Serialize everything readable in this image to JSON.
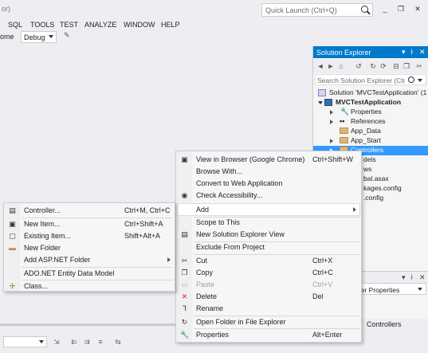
{
  "window": {
    "title_fragment": "or)",
    "quick_launch_placeholder": "Quick Launch (Ctrl+Q)",
    "minimize": "_",
    "maximize": "❐",
    "close": "✕"
  },
  "menubar": {
    "items": [
      "SQL",
      "TOOLS",
      "TEST",
      "ANALYZE",
      "WINDOW",
      "HELP"
    ]
  },
  "toolbar": {
    "browser_fragment": "ome",
    "config_value": "Debug"
  },
  "solution_explorer": {
    "title": "Solution Explorer",
    "search_placeholder": "Search Solution Explorer (Ctrl+;)",
    "tree": {
      "solution": "Solution 'MVCTestApplication' (1",
      "project": "MVCTestApplication",
      "properties": "Properties",
      "references": "References",
      "app_data": "App_Data",
      "app_start": "App_Start",
      "controllers": "Controllers",
      "frag_models": "dels",
      "frag_views": "ws",
      "frag_global": "bal.asax",
      "frag_packages": "kages.config",
      "frag_webconfig": ".config"
    }
  },
  "properties_panel": {
    "title_fragment": "der Properties",
    "object_label": "Controllers"
  },
  "context_menu": {
    "items": [
      {
        "label": "View in Browser (Google Chrome)",
        "shortcut": "Ctrl+Shift+W",
        "icon": "browser-icon"
      },
      {
        "label": "Browse With...",
        "shortcut": ""
      },
      {
        "label": "Convert to Web Application",
        "shortcut": ""
      },
      {
        "label": "Check Accessibility...",
        "shortcut": "",
        "icon": "accessibility-icon"
      },
      {
        "label": "Add",
        "shortcut": "",
        "submenu": true
      },
      {
        "label": "Scope to This",
        "shortcut": ""
      },
      {
        "label": "New Solution Explorer View",
        "shortcut": "",
        "icon": "new-view-icon"
      },
      {
        "label": "Exclude From Project",
        "shortcut": ""
      },
      {
        "label": "Cut",
        "shortcut": "Ctrl+X",
        "icon": "cut-icon"
      },
      {
        "label": "Copy",
        "shortcut": "Ctrl+C",
        "icon": "copy-icon"
      },
      {
        "label": "Paste",
        "shortcut": "Ctrl+V",
        "icon": "paste-icon",
        "disabled": true
      },
      {
        "label": "Delete",
        "shortcut": "Del",
        "icon": "delete-icon"
      },
      {
        "label": "Rename",
        "shortcut": "",
        "icon": "rename-icon"
      },
      {
        "label": "Open Folder in File Explorer",
        "shortcut": "",
        "icon": "open-folder-icon"
      },
      {
        "label": "Properties",
        "shortcut": "Alt+Enter",
        "icon": "wrench-icon"
      }
    ]
  },
  "add_submenu": {
    "items": [
      {
        "label": "Controller...",
        "shortcut": "Ctrl+M, Ctrl+C",
        "icon": "controller-icon"
      },
      {
        "label": "New Item...",
        "shortcut": "Ctrl+Shift+A",
        "icon": "new-item-icon"
      },
      {
        "label": "Existing Item...",
        "shortcut": "Shift+Alt+A",
        "icon": "existing-item-icon"
      },
      {
        "label": "New Folder",
        "shortcut": "",
        "icon": "new-folder-icon"
      },
      {
        "label": "Add ASP.NET Folder",
        "shortcut": "",
        "submenu": true
      },
      {
        "label": "ADO.NET Entity Data Model",
        "shortcut": ""
      },
      {
        "label": "Class...",
        "shortcut": "",
        "icon": "class-icon"
      }
    ]
  },
  "colors": {
    "accent": "#007acc",
    "selection": "#3399ff",
    "delete_red": "#d9291c"
  }
}
